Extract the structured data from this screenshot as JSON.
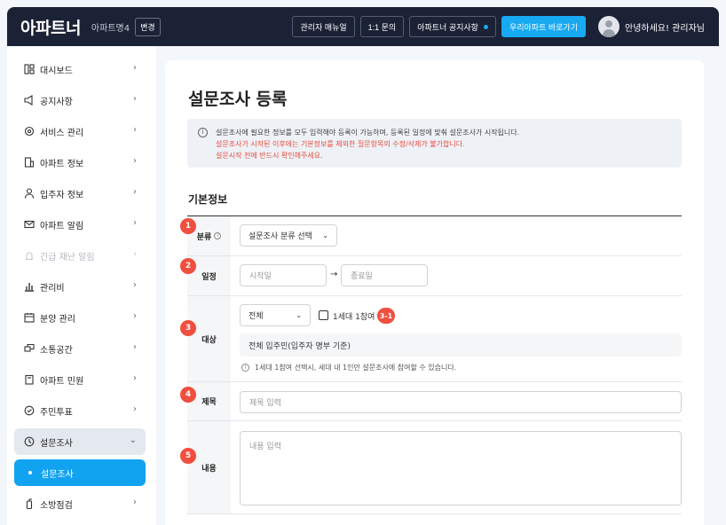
{
  "header": {
    "logo": "아파트너",
    "apt_name": "아파트명4",
    "change_label": "변경",
    "buttons": {
      "manual": "관리자 매뉴얼",
      "inquiry": "1:1 문의",
      "notice": "아파트너 공지사항",
      "go_apt": "우리아파트 바로가기"
    },
    "greeting": "안녕하세요! 관리자님"
  },
  "sidebar": {
    "items": [
      {
        "label": "대시보드",
        "icon": "dashboard-icon"
      },
      {
        "label": "공지사항",
        "icon": "megaphone-icon"
      },
      {
        "label": "서비스 관리",
        "icon": "gear-icon"
      },
      {
        "label": "아파트 정보",
        "icon": "building-icon"
      },
      {
        "label": "입주자 정보",
        "icon": "person-icon"
      },
      {
        "label": "아파트 알림",
        "icon": "mail-icon"
      },
      {
        "label": "긴급 재난 알림",
        "icon": "alert-icon"
      },
      {
        "label": "관리비",
        "icon": "bar-chart-icon"
      },
      {
        "label": "분양 관리",
        "icon": "calendar-icon"
      },
      {
        "label": "소통공간",
        "icon": "chat-icon"
      },
      {
        "label": "아파트 민원",
        "icon": "clipboard-icon"
      },
      {
        "label": "주민투표",
        "icon": "vote-icon"
      },
      {
        "label": "설문조사",
        "icon": "clock-icon"
      },
      {
        "label": "설문조사",
        "icon": "bullet-icon"
      },
      {
        "label": "소방점검",
        "icon": "extinguisher-icon"
      }
    ]
  },
  "main": {
    "title": "설문조사 등록",
    "notice": {
      "line1": "설문조사에 필요한 정보를 모두 입력해야 등록이 가능하며, 등록된 일정에 맞춰 설문조사가 시작됩니다.",
      "line2": "설문조사가 시작된 이후에는 기본정보를 제외한 질문항목의 수정/삭제가 불가합니다.",
      "line3": "설문시작 전에 반드시 확인해주세요."
    },
    "section_title": "기본정보",
    "fields": {
      "category": {
        "badge": "1",
        "label": "분류",
        "select_value": "설문조사 분류 선택"
      },
      "schedule": {
        "badge": "2",
        "label": "일정",
        "start_placeholder": "시작일",
        "end_placeholder": "종료일"
      },
      "target": {
        "badge": "3",
        "label": "대상",
        "select_value": "전체",
        "checkbox_label": "1세대 1참여",
        "checkbox_badge": "3-1",
        "summary": "전체 입주민(입주자 명부 기준)",
        "hint": "1세대 1참여 선택시, 세대 내 1인만 설문조사에 참여할 수 있습니다."
      },
      "subject": {
        "badge": "4",
        "label": "제목",
        "placeholder": "제목 입력"
      },
      "content": {
        "badge": "5",
        "label": "내용",
        "placeholder": "내용 입력"
      }
    }
  },
  "colors": {
    "header_bg": "#1c2236",
    "accent": "#12a3f0",
    "badge": "#f04e3e",
    "warning_text": "#e84b3c"
  }
}
